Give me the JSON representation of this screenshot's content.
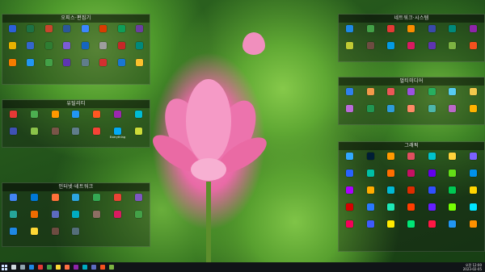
{
  "fences": [
    {
      "key": "fence-documents-editing",
      "title": "오피스·편집기",
      "columns": 8,
      "icons": [
        {
          "color": "#2b5fd9",
          "label": ""
        },
        {
          "color": "#1e7145",
          "label": ""
        },
        {
          "color": "#c8452d",
          "label": ""
        },
        {
          "color": "#2b579a",
          "label": ""
        },
        {
          "color": "#3a86ff",
          "label": ""
        },
        {
          "color": "#d83b01",
          "label": ""
        },
        {
          "color": "#0f9d58",
          "label": ""
        },
        {
          "color": "#6b3fa0",
          "label": ""
        },
        {
          "color": "#e8b200",
          "label": ""
        },
        {
          "color": "#3366cc",
          "label": ""
        },
        {
          "color": "#2e7d32",
          "label": ""
        },
        {
          "color": "#7b5cd6",
          "label": ""
        },
        {
          "color": "#1565c0",
          "label": ""
        },
        {
          "color": "#9e9e9e",
          "label": ""
        },
        {
          "color": "#c62828",
          "label": ""
        },
        {
          "color": "#00897b",
          "label": ""
        },
        {
          "color": "#f57c00",
          "label": ""
        },
        {
          "color": "#2196f3",
          "label": ""
        },
        {
          "color": "#43a047",
          "label": ""
        },
        {
          "color": "#5e35b1",
          "label": ""
        },
        {
          "color": "#607d8b",
          "label": ""
        },
        {
          "color": "#d32f2f",
          "label": ""
        },
        {
          "color": "#1976d2",
          "label": ""
        },
        {
          "color": "#fbc02d",
          "label": ""
        }
      ]
    },
    {
      "key": "fence-utilities",
      "title": "유틸리티",
      "columns": 7,
      "icons": [
        {
          "color": "#e53935",
          "label": ""
        },
        {
          "color": "#4caf50",
          "label": ""
        },
        {
          "color": "#ff9800",
          "label": ""
        },
        {
          "color": "#2196f3",
          "label": ""
        },
        {
          "color": "#ff5722",
          "label": ""
        },
        {
          "color": "#9c27b0",
          "label": ""
        },
        {
          "color": "#00bcd4",
          "label": ""
        },
        {
          "color": "#3f51b5",
          "label": ""
        },
        {
          "color": "#8bc34a",
          "label": ""
        },
        {
          "color": "#795548",
          "label": ""
        },
        {
          "color": "#607d8b",
          "label": ""
        },
        {
          "color": "#f44336",
          "label": ""
        },
        {
          "color": "#03a9f4",
          "label": "Everything"
        },
        {
          "color": "#cddc39",
          "label": ""
        }
      ]
    },
    {
      "key": "fence-internet-network",
      "title": "인터넷·네트워크",
      "columns": 7,
      "icons": [
        {
          "color": "#4285f4",
          "label": ""
        },
        {
          "color": "#0078d7",
          "label": ""
        },
        {
          "color": "#ff7139",
          "label": ""
        },
        {
          "color": "#2ca5e0",
          "label": ""
        },
        {
          "color": "#34a853",
          "label": ""
        },
        {
          "color": "#ea4335",
          "label": ""
        },
        {
          "color": "#7e57c2",
          "label": ""
        },
        {
          "color": "#26a69a",
          "label": ""
        },
        {
          "color": "#ef6c00",
          "label": ""
        },
        {
          "color": "#5c6bc0",
          "label": ""
        },
        {
          "color": "#00acc1",
          "label": ""
        },
        {
          "color": "#8d6e63",
          "label": ""
        },
        {
          "color": "#d81b60",
          "label": ""
        },
        {
          "color": "#43a047",
          "label": ""
        },
        {
          "color": "#1e88e5",
          "label": ""
        },
        {
          "color": "#fdd835",
          "label": ""
        },
        {
          "color": "#6d4c41",
          "label": ""
        },
        {
          "color": "#546e7a",
          "label": ""
        }
      ]
    },
    {
      "key": "fence-network-system",
      "title": "네트워크·시스템",
      "columns": 7,
      "icons": [
        {
          "color": "#1e88e5",
          "label": ""
        },
        {
          "color": "#43a047",
          "label": ""
        },
        {
          "color": "#e53935",
          "label": ""
        },
        {
          "color": "#fb8c00",
          "label": ""
        },
        {
          "color": "#3949ab",
          "label": ""
        },
        {
          "color": "#00897b",
          "label": ""
        },
        {
          "color": "#8e24aa",
          "label": ""
        },
        {
          "color": "#c0ca33",
          "label": ""
        },
        {
          "color": "#6d4c41",
          "label": ""
        },
        {
          "color": "#039be5",
          "label": ""
        },
        {
          "color": "#d81b60",
          "label": ""
        },
        {
          "color": "#5e35b1",
          "label": ""
        },
        {
          "color": "#7cb342",
          "label": ""
        },
        {
          "color": "#f4511e",
          "label": ""
        }
      ]
    },
    {
      "key": "fence-multimedia",
      "title": "멀티미디어",
      "columns": 7,
      "icons": [
        {
          "color": "#2f80ed",
          "label": ""
        },
        {
          "color": "#f2994a",
          "label": ""
        },
        {
          "color": "#eb5757",
          "label": ""
        },
        {
          "color": "#9b51e0",
          "label": ""
        },
        {
          "color": "#27ae60",
          "label": ""
        },
        {
          "color": "#56ccf2",
          "label": ""
        },
        {
          "color": "#f2c94c",
          "label": ""
        },
        {
          "color": "#bb6bd9",
          "label": ""
        },
        {
          "color": "#219653",
          "label": ""
        },
        {
          "color": "#2d9cdb",
          "label": ""
        },
        {
          "color": "#ff8a65",
          "label": ""
        },
        {
          "color": "#4db6ac",
          "label": ""
        },
        {
          "color": "#ba68c8",
          "label": ""
        },
        {
          "color": "#ffb300",
          "label": ""
        }
      ]
    },
    {
      "key": "fence-graphics",
      "title": "그래픽",
      "columns": 7,
      "icons": [
        {
          "color": "#31a8ff",
          "label": ""
        },
        {
          "color": "#001e36",
          "label": ""
        },
        {
          "color": "#ff9a00",
          "label": ""
        },
        {
          "color": "#e04f5f",
          "label": ""
        },
        {
          "color": "#00c4cc",
          "label": ""
        },
        {
          "color": "#ffd43b",
          "label": ""
        },
        {
          "color": "#7b61ff",
          "label": ""
        },
        {
          "color": "#2962ff",
          "label": ""
        },
        {
          "color": "#00bfa5",
          "label": ""
        },
        {
          "color": "#ff6d00",
          "label": ""
        },
        {
          "color": "#c51162",
          "label": ""
        },
        {
          "color": "#6200ea",
          "label": ""
        },
        {
          "color": "#64dd17",
          "label": ""
        },
        {
          "color": "#0091ea",
          "label": ""
        },
        {
          "color": "#aa00ff",
          "label": ""
        },
        {
          "color": "#ffab00",
          "label": ""
        },
        {
          "color": "#00b8d4",
          "label": ""
        },
        {
          "color": "#dd2c00",
          "label": ""
        },
        {
          "color": "#304ffe",
          "label": ""
        },
        {
          "color": "#00c853",
          "label": ""
        },
        {
          "color": "#ffd600",
          "label": ""
        },
        {
          "color": "#d50000",
          "label": ""
        },
        {
          "color": "#2979ff",
          "label": ""
        },
        {
          "color": "#1de9b6",
          "label": ""
        },
        {
          "color": "#ff3d00",
          "label": ""
        },
        {
          "color": "#651fff",
          "label": ""
        },
        {
          "color": "#76ff03",
          "label": ""
        },
        {
          "color": "#00e5ff",
          "label": ""
        },
        {
          "color": "#f50057",
          "label": ""
        },
        {
          "color": "#3d5afe",
          "label": ""
        },
        {
          "color": "#ffea00",
          "label": ""
        },
        {
          "color": "#00e676",
          "label": ""
        },
        {
          "color": "#ff1744",
          "label": ""
        },
        {
          "color": "#2196f3",
          "label": ""
        },
        {
          "color": "#ff9100",
          "label": ""
        }
      ]
    }
  ],
  "taskbar": {
    "icons": [
      {
        "color": "#cfd8dc"
      },
      {
        "color": "#90a4ae"
      },
      {
        "color": "#1e88e5"
      },
      {
        "color": "#e53935"
      },
      {
        "color": "#43a047"
      },
      {
        "color": "#fdd835"
      },
      {
        "color": "#ff7043"
      },
      {
        "color": "#8e24aa"
      },
      {
        "color": "#00acc1"
      },
      {
        "color": "#5c6bc0"
      },
      {
        "color": "#f4511e"
      },
      {
        "color": "#7cb342"
      }
    ],
    "clock_time": "오전 12:00",
    "clock_date": "2023-02-05"
  }
}
